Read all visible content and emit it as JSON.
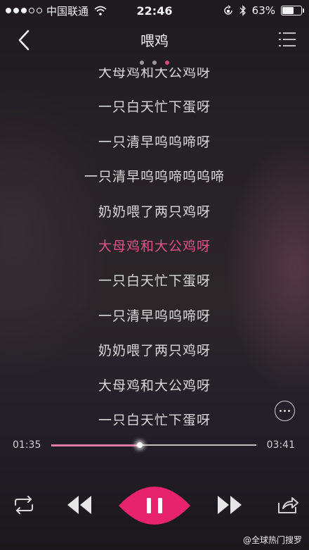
{
  "status_bar": {
    "carrier": "中国联通",
    "time": "22:46",
    "battery_percent": "63%",
    "battery_level": 0.63,
    "signal_dots_filled": 3,
    "icons": [
      "wifi-icon",
      "orientation-lock-icon",
      "bluetooth-icon",
      "battery-icon"
    ]
  },
  "nav": {
    "title": "喂鸡",
    "back_icon": "chevron-left-icon",
    "playlist_icon": "playlist-icon"
  },
  "pager": {
    "count": 3,
    "active_index": 2
  },
  "lyrics": {
    "lines": [
      "大母鸡和大公鸡呀",
      "一只白天忙下蛋呀",
      "一只清早呜呜啼呀",
      "一只清早呜呜啼呜呜啼",
      "奶奶喂了两只鸡呀",
      "大母鸡和大公鸡呀",
      "一只白天忙下蛋呀",
      "一只清早呜呜啼呀",
      "奶奶喂了两只鸡呀",
      "大母鸡和大公鸡呀",
      "一只白天忙下蛋呀"
    ],
    "current_index": 5
  },
  "more_icon": "more-icon",
  "progress": {
    "elapsed": "01:35",
    "total": "03:41",
    "fraction": 0.43
  },
  "controls": {
    "icons": [
      "repeat-icon",
      "previous-icon",
      "pause-icon",
      "next-icon",
      "share-icon"
    ],
    "accent": "#e8236e"
  },
  "watermark": "@全球热门搜罗"
}
